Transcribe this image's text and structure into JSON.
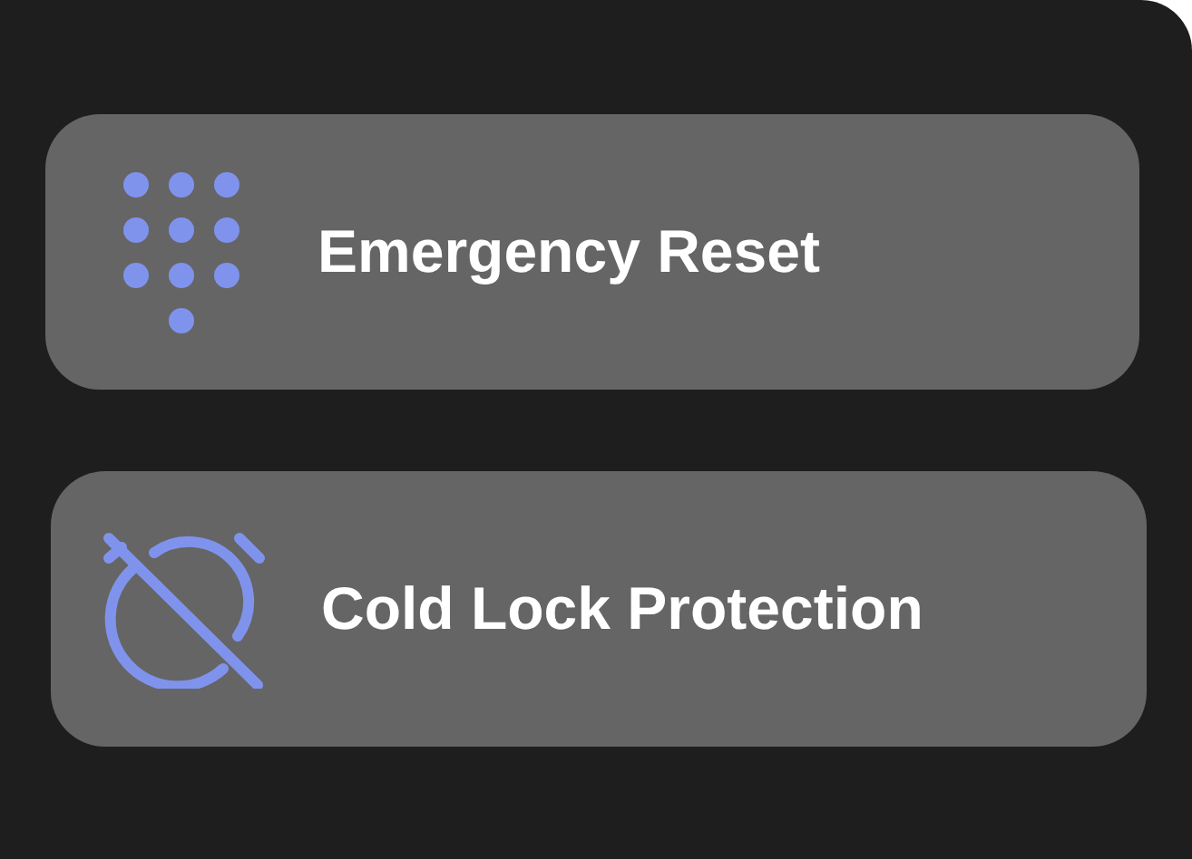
{
  "items": [
    {
      "kind": "keypad",
      "label": "Emergency Reset"
    },
    {
      "kind": "alarm-off",
      "label": "Cold Lock Protection"
    }
  ]
}
